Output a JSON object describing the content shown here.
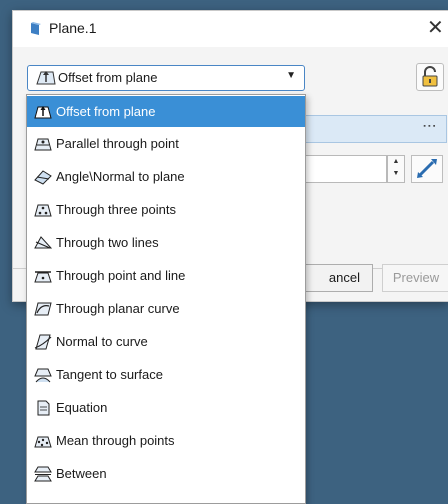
{
  "dialog": {
    "title": "Plane.1",
    "close_glyph": "✕",
    "plane_type": "Offset from plane",
    "dots_glyph": "⋮",
    "spinner_up": "▲",
    "spinner_down": "▼",
    "cancel_label": "ancel",
    "preview_label": "Preview"
  },
  "dropdown": {
    "options": [
      {
        "label": "Offset from plane",
        "icon": "offset-plane-icon"
      },
      {
        "label": "Parallel through point",
        "icon": "parallel-point-icon"
      },
      {
        "label": "Angle\\Normal to plane",
        "icon": "angle-normal-icon"
      },
      {
        "label": "Through three points",
        "icon": "three-points-icon"
      },
      {
        "label": "Through two lines",
        "icon": "two-lines-icon"
      },
      {
        "label": "Through point and line",
        "icon": "point-line-icon"
      },
      {
        "label": "Through planar curve",
        "icon": "planar-curve-icon"
      },
      {
        "label": "Normal to curve",
        "icon": "normal-curve-icon"
      },
      {
        "label": "Tangent to surface",
        "icon": "tangent-surface-icon"
      },
      {
        "label": "Equation",
        "icon": "equation-icon"
      },
      {
        "label": "Mean through points",
        "icon": "mean-points-icon"
      },
      {
        "label": "Between",
        "icon": "between-icon"
      }
    ],
    "selected": "Offset from plane"
  },
  "colors": {
    "background": "#3d6280",
    "selection": "#3a8fd6",
    "field_highlight": "#dbe9f6"
  }
}
